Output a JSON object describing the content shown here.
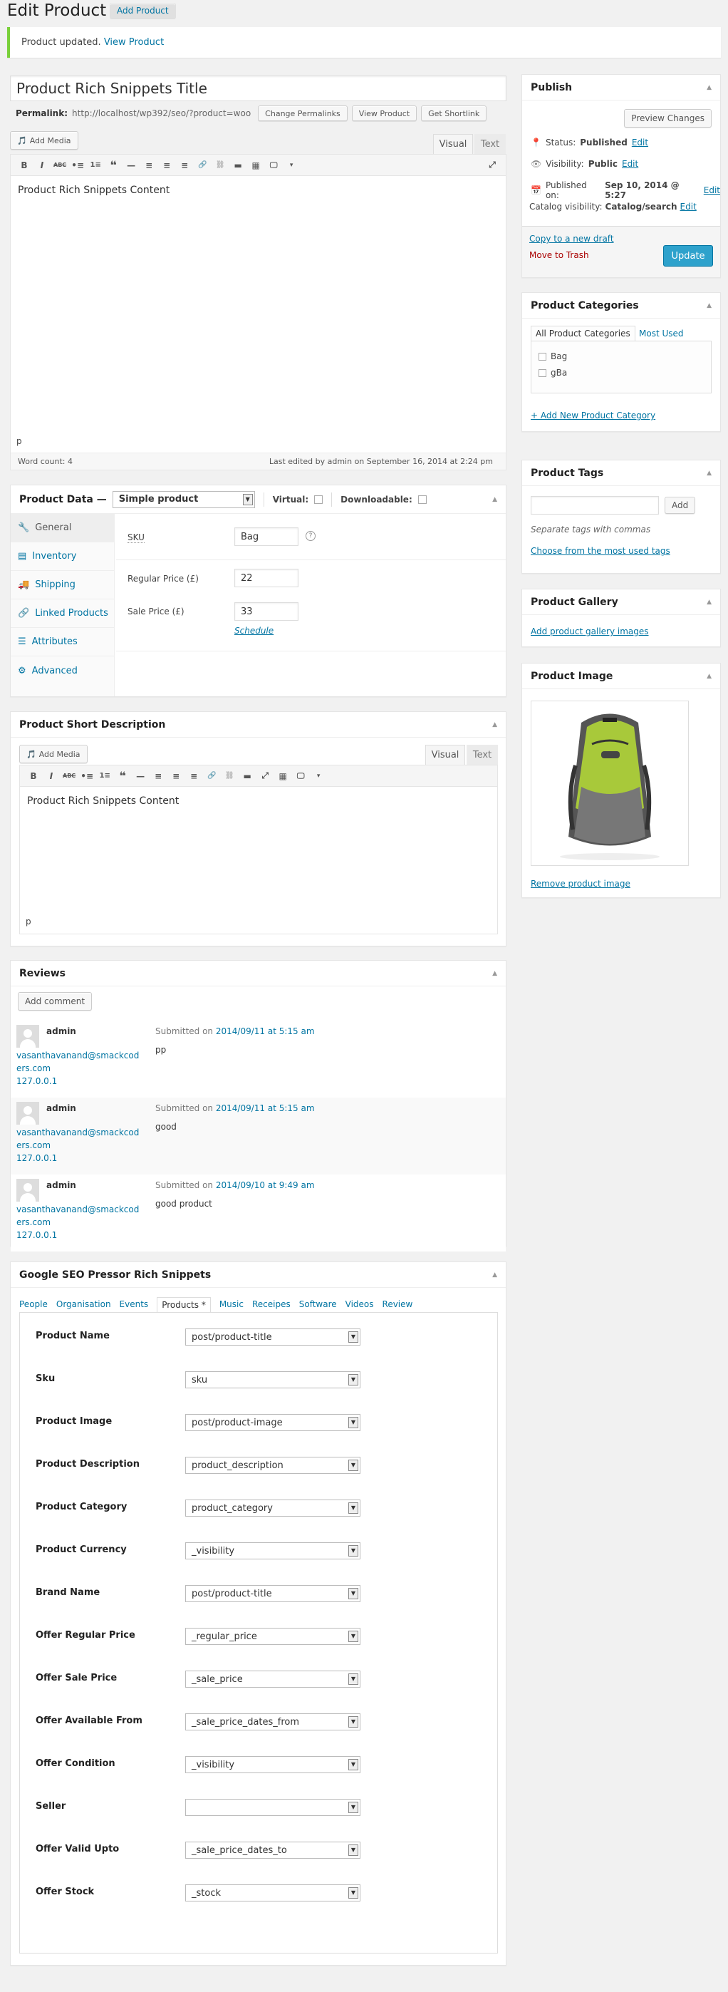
{
  "header": {
    "title": "Edit Product",
    "add_button": "Add Product"
  },
  "notice": {
    "text": "Product updated.",
    "link": "View Product"
  },
  "title_field": {
    "value": "Product Rich Snippets Title"
  },
  "permalink": {
    "label": "Permalink:",
    "url": "http://localhost/wp392/seo/?product=woo",
    "buttons": [
      "Change Permalinks",
      "View Product",
      "Get Shortlink"
    ]
  },
  "editor": {
    "add_media": "Add Media",
    "tab_visual": "Visual",
    "tab_text": "Text",
    "toolbar": [
      "B",
      "I",
      "ABC",
      "•≡",
      "1≡",
      "❝",
      "—",
      "≡",
      "≡",
      "≡",
      "🔗",
      "⛓",
      "▬",
      "▦",
      "🖵",
      "▾"
    ],
    "content": "Product Rich Snippets Content",
    "path": "p",
    "word_count": "Word count: 4",
    "last_edited": "Last edited by admin on September 16, 2014 at 2:24 pm"
  },
  "product_data": {
    "title": "Product Data —",
    "type": "Simple product",
    "virtual": "Virtual:",
    "downloadable": "Downloadable:",
    "tabs": [
      {
        "label": "General",
        "icon": "wrench-icon"
      },
      {
        "label": "Inventory",
        "icon": "inventory-icon"
      },
      {
        "label": "Shipping",
        "icon": "truck-icon"
      },
      {
        "label": "Linked Products",
        "icon": "link-icon"
      },
      {
        "label": "Attributes",
        "icon": "list-icon"
      },
      {
        "label": "Advanced",
        "icon": "gear-icon"
      }
    ],
    "sku_label": "SKU",
    "sku": "Bag",
    "help": "?",
    "regular_label": "Regular Price (£)",
    "regular": "22",
    "sale_label": "Sale Price (£)",
    "sale": "33",
    "schedule": "Schedule"
  },
  "short_desc": {
    "title": "Product Short Description",
    "add_media": "Add Media",
    "tab_visual": "Visual",
    "tab_text": "Text",
    "content": "Product Rich Snippets Content",
    "path": "p"
  },
  "reviews": {
    "title": "Reviews",
    "add_comment": "Add comment",
    "items": [
      {
        "author": "admin",
        "email1": "vasanthavanand@smackcod",
        "email2": "ers.com",
        "ip": "127.0.0.1",
        "submitted": "Submitted on",
        "date": "2014/09/11 at 5:15 am",
        "text": "pp"
      },
      {
        "author": "admin",
        "email1": "vasanthavanand@smackcod",
        "email2": "ers.com",
        "ip": "127.0.0.1",
        "submitted": "Submitted on",
        "date": "2014/09/11 at 5:15 am",
        "text": "good"
      },
      {
        "author": "admin",
        "email1": "vasanthavanand@smackcod",
        "email2": "ers.com",
        "ip": "127.0.0.1",
        "submitted": "Submitted on",
        "date": "2014/09/10 at 9:49 am",
        "text": "good product"
      }
    ]
  },
  "seo": {
    "title": "Google SEO Pressor Rich Snippets",
    "tabs": [
      "People",
      "Organisation",
      "Events",
      "Products *",
      "Music",
      "Receipes",
      "Software",
      "Videos",
      "Review"
    ],
    "rows": [
      {
        "label": "Product Name",
        "value": "post/product-title"
      },
      {
        "label": "Sku",
        "value": "sku"
      },
      {
        "label": "Product Image",
        "value": "post/product-image"
      },
      {
        "label": "Product Description",
        "value": "product_description"
      },
      {
        "label": "Product Category",
        "value": "product_category"
      },
      {
        "label": "Product Currency",
        "value": "_visibility"
      },
      {
        "label": "Brand Name",
        "value": "post/product-title"
      },
      {
        "label": "Offer Regular Price",
        "value": "_regular_price"
      },
      {
        "label": "Offer Sale Price",
        "value": "_sale_price"
      },
      {
        "label": "Offer Available From",
        "value": "_sale_price_dates_from"
      },
      {
        "label": "Offer Condition",
        "value": "_visibility"
      },
      {
        "label": "Seller",
        "value": ""
      },
      {
        "label": "Offer Valid Upto",
        "value": "_sale_price_dates_to"
      },
      {
        "label": "Offer Stock",
        "value": "_stock"
      }
    ]
  },
  "publish": {
    "title": "Publish",
    "preview": "Preview Changes",
    "status_label": "Status:",
    "status": "Published",
    "visibility_label": "Visibility:",
    "visibility": "Public",
    "published_label": "Published on:",
    "published": "Sep 10, 2014 @ 5:27",
    "catalog_label": "Catalog visibility:",
    "catalog": "Catalog/search",
    "edit": "Edit",
    "copy": "Copy to a new draft",
    "trash": "Move to Trash",
    "update": "Update"
  },
  "categories": {
    "title": "Product Categories",
    "tab_all": "All Product Categories",
    "tab_most": "Most Used",
    "items": [
      "Bag",
      "gBa"
    ],
    "add": "+ Add New Product Category"
  },
  "tags": {
    "title": "Product Tags",
    "add": "Add",
    "hint": "Separate tags with commas",
    "choose": "Choose from the most used tags"
  },
  "gallery": {
    "title": "Product Gallery",
    "link": "Add product gallery images"
  },
  "image": {
    "title": "Product Image",
    "remove": "Remove product image"
  },
  "colors": {
    "link": "#0074a2",
    "primary": "#2ea2cc",
    "trash": "#a00",
    "notice": "#7ad03a"
  }
}
